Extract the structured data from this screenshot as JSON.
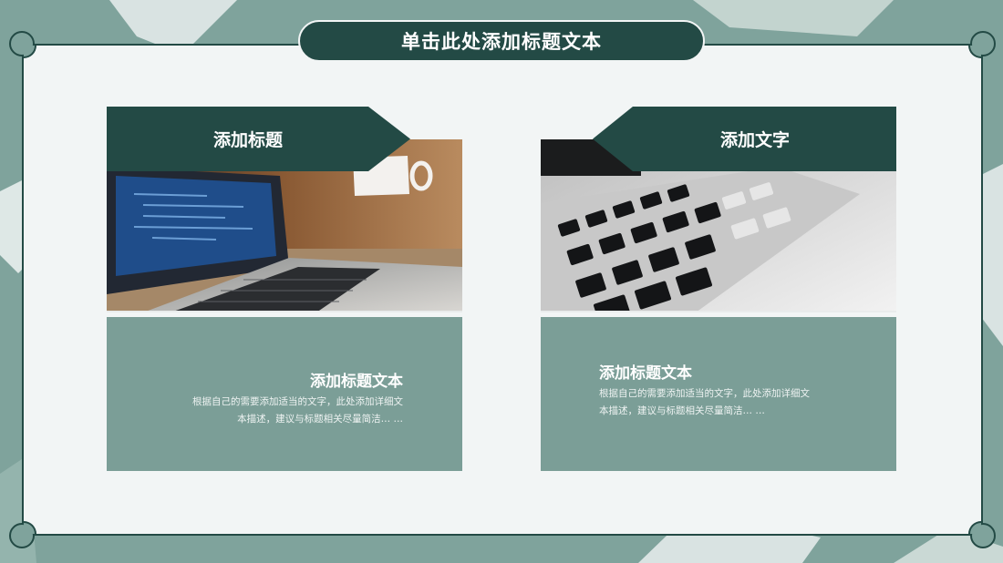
{
  "slide": {
    "title": "单击此处添加标题文本"
  },
  "cards": [
    {
      "banner": "添加标题",
      "subtitle": "添加标题文本",
      "desc_line1": "根据自己的需要添加适当的文字，此处添加详细文",
      "desc_line2": "本描述，建议与标题相关尽量简洁… …"
    },
    {
      "banner": "添加文字",
      "subtitle": "添加标题文本",
      "desc_line1": "根据自己的需要添加适当的文字，此处添加详细文",
      "desc_line2": "本描述，建议与标题相关尽量简洁… …"
    }
  ],
  "colors": {
    "dark_green": "#234a45",
    "sage": "#7b9e97",
    "panel": "#f2f5f5"
  }
}
